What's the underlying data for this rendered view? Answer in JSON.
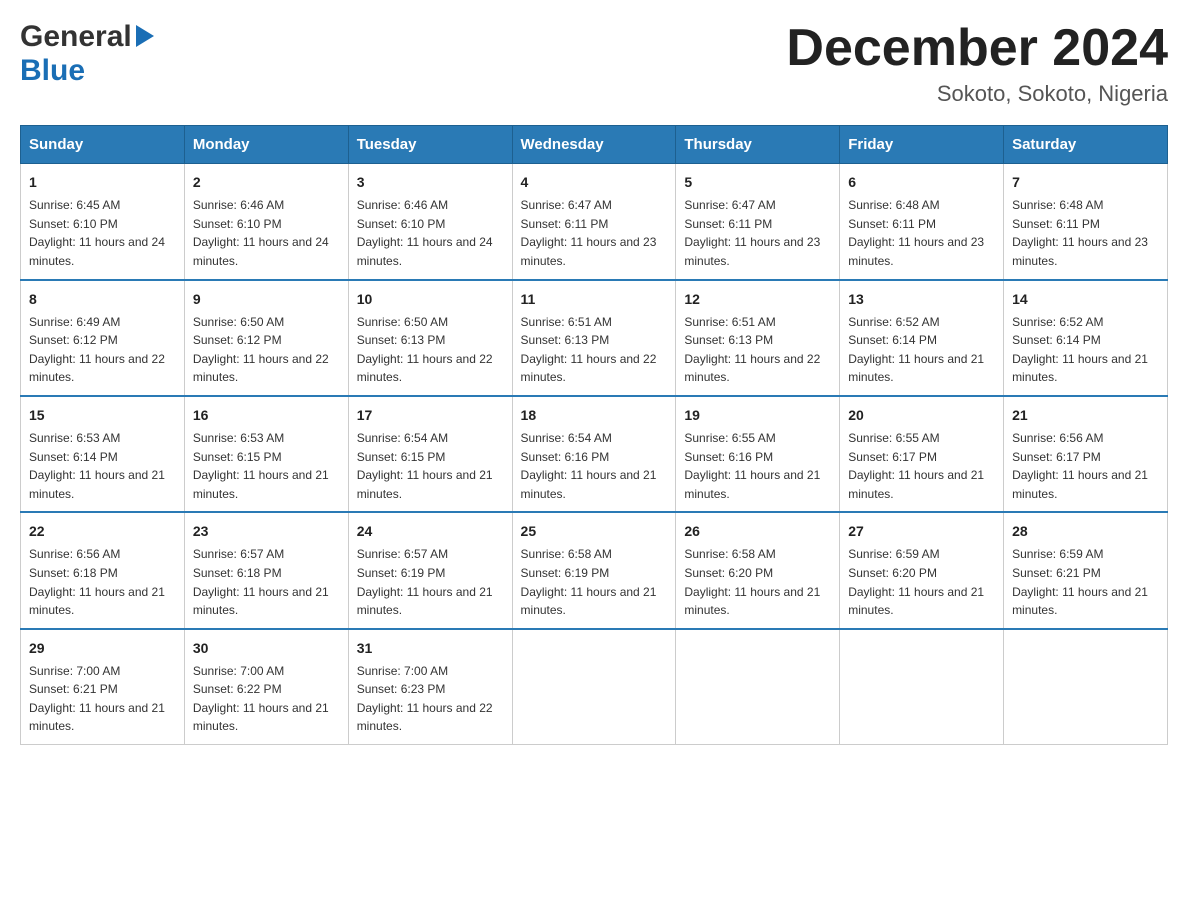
{
  "header": {
    "logo_general": "General",
    "logo_blue": "Blue",
    "month_title": "December 2024",
    "location": "Sokoto, Sokoto, Nigeria"
  },
  "weekdays": [
    "Sunday",
    "Monday",
    "Tuesday",
    "Wednesday",
    "Thursday",
    "Friday",
    "Saturday"
  ],
  "weeks": [
    [
      {
        "day": "1",
        "sunrise": "6:45 AM",
        "sunset": "6:10 PM",
        "daylight": "11 hours and 24 minutes."
      },
      {
        "day": "2",
        "sunrise": "6:46 AM",
        "sunset": "6:10 PM",
        "daylight": "11 hours and 24 minutes."
      },
      {
        "day": "3",
        "sunrise": "6:46 AM",
        "sunset": "6:10 PM",
        "daylight": "11 hours and 24 minutes."
      },
      {
        "day": "4",
        "sunrise": "6:47 AM",
        "sunset": "6:11 PM",
        "daylight": "11 hours and 23 minutes."
      },
      {
        "day": "5",
        "sunrise": "6:47 AM",
        "sunset": "6:11 PM",
        "daylight": "11 hours and 23 minutes."
      },
      {
        "day": "6",
        "sunrise": "6:48 AM",
        "sunset": "6:11 PM",
        "daylight": "11 hours and 23 minutes."
      },
      {
        "day": "7",
        "sunrise": "6:48 AM",
        "sunset": "6:11 PM",
        "daylight": "11 hours and 23 minutes."
      }
    ],
    [
      {
        "day": "8",
        "sunrise": "6:49 AM",
        "sunset": "6:12 PM",
        "daylight": "11 hours and 22 minutes."
      },
      {
        "day": "9",
        "sunrise": "6:50 AM",
        "sunset": "6:12 PM",
        "daylight": "11 hours and 22 minutes."
      },
      {
        "day": "10",
        "sunrise": "6:50 AM",
        "sunset": "6:13 PM",
        "daylight": "11 hours and 22 minutes."
      },
      {
        "day": "11",
        "sunrise": "6:51 AM",
        "sunset": "6:13 PM",
        "daylight": "11 hours and 22 minutes."
      },
      {
        "day": "12",
        "sunrise": "6:51 AM",
        "sunset": "6:13 PM",
        "daylight": "11 hours and 22 minutes."
      },
      {
        "day": "13",
        "sunrise": "6:52 AM",
        "sunset": "6:14 PM",
        "daylight": "11 hours and 21 minutes."
      },
      {
        "day": "14",
        "sunrise": "6:52 AM",
        "sunset": "6:14 PM",
        "daylight": "11 hours and 21 minutes."
      }
    ],
    [
      {
        "day": "15",
        "sunrise": "6:53 AM",
        "sunset": "6:14 PM",
        "daylight": "11 hours and 21 minutes."
      },
      {
        "day": "16",
        "sunrise": "6:53 AM",
        "sunset": "6:15 PM",
        "daylight": "11 hours and 21 minutes."
      },
      {
        "day": "17",
        "sunrise": "6:54 AM",
        "sunset": "6:15 PM",
        "daylight": "11 hours and 21 minutes."
      },
      {
        "day": "18",
        "sunrise": "6:54 AM",
        "sunset": "6:16 PM",
        "daylight": "11 hours and 21 minutes."
      },
      {
        "day": "19",
        "sunrise": "6:55 AM",
        "sunset": "6:16 PM",
        "daylight": "11 hours and 21 minutes."
      },
      {
        "day": "20",
        "sunrise": "6:55 AM",
        "sunset": "6:17 PM",
        "daylight": "11 hours and 21 minutes."
      },
      {
        "day": "21",
        "sunrise": "6:56 AM",
        "sunset": "6:17 PM",
        "daylight": "11 hours and 21 minutes."
      }
    ],
    [
      {
        "day": "22",
        "sunrise": "6:56 AM",
        "sunset": "6:18 PM",
        "daylight": "11 hours and 21 minutes."
      },
      {
        "day": "23",
        "sunrise": "6:57 AM",
        "sunset": "6:18 PM",
        "daylight": "11 hours and 21 minutes."
      },
      {
        "day": "24",
        "sunrise": "6:57 AM",
        "sunset": "6:19 PM",
        "daylight": "11 hours and 21 minutes."
      },
      {
        "day": "25",
        "sunrise": "6:58 AM",
        "sunset": "6:19 PM",
        "daylight": "11 hours and 21 minutes."
      },
      {
        "day": "26",
        "sunrise": "6:58 AM",
        "sunset": "6:20 PM",
        "daylight": "11 hours and 21 minutes."
      },
      {
        "day": "27",
        "sunrise": "6:59 AM",
        "sunset": "6:20 PM",
        "daylight": "11 hours and 21 minutes."
      },
      {
        "day": "28",
        "sunrise": "6:59 AM",
        "sunset": "6:21 PM",
        "daylight": "11 hours and 21 minutes."
      }
    ],
    [
      {
        "day": "29",
        "sunrise": "7:00 AM",
        "sunset": "6:21 PM",
        "daylight": "11 hours and 21 minutes."
      },
      {
        "day": "30",
        "sunrise": "7:00 AM",
        "sunset": "6:22 PM",
        "daylight": "11 hours and 21 minutes."
      },
      {
        "day": "31",
        "sunrise": "7:00 AM",
        "sunset": "6:23 PM",
        "daylight": "11 hours and 22 minutes."
      },
      null,
      null,
      null,
      null
    ]
  ],
  "labels": {
    "sunrise": "Sunrise: ",
    "sunset": "Sunset: ",
    "daylight": "Daylight: "
  }
}
